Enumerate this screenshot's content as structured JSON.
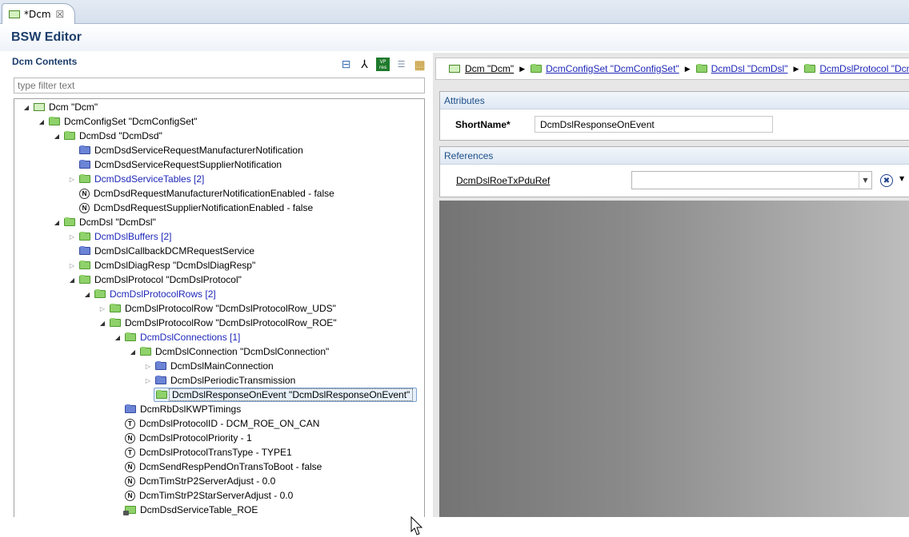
{
  "tab": {
    "title": "*Dcm",
    "close": "☒"
  },
  "editor": {
    "title": "BSW Editor"
  },
  "contents": {
    "title": "Dcm Contents",
    "filter_placeholder": "type filter text"
  },
  "toolbar": {
    "collapse": "⊟",
    "link": "⅄",
    "vp": "VP res",
    "doc": "☰",
    "grid": "▦"
  },
  "tree": [
    {
      "indent": 0,
      "tw": "open",
      "icon": "module",
      "label": "Dcm \"Dcm\"",
      "blue": false
    },
    {
      "indent": 1,
      "tw": "open",
      "icon": "green",
      "label": "DcmConfigSet \"DcmConfigSet\"",
      "blue": false
    },
    {
      "indent": 2,
      "tw": "open",
      "icon": "green",
      "label": "DcmDsd \"DcmDsd\"",
      "blue": false
    },
    {
      "indent": 3,
      "tw": "none",
      "icon": "blue",
      "label": "DcmDsdServiceRequestManufacturerNotification",
      "blue": false
    },
    {
      "indent": 3,
      "tw": "none",
      "icon": "blue",
      "label": "DcmDsdServiceRequestSupplierNotification",
      "blue": false
    },
    {
      "indent": 3,
      "tw": "closed",
      "icon": "green",
      "label": "DcmDsdServiceTables [2]",
      "blue": true
    },
    {
      "indent": 3,
      "tw": "none",
      "icon": "N",
      "label": "DcmDsdRequestManufacturerNotificationEnabled - false",
      "blue": false
    },
    {
      "indent": 3,
      "tw": "none",
      "icon": "N",
      "label": "DcmDsdRequestSupplierNotificationEnabled - false",
      "blue": false
    },
    {
      "indent": 2,
      "tw": "open",
      "icon": "green",
      "label": "DcmDsl \"DcmDsl\"",
      "blue": false
    },
    {
      "indent": 3,
      "tw": "closed",
      "icon": "green",
      "label": "DcmDslBuffers [2]",
      "blue": true
    },
    {
      "indent": 3,
      "tw": "none",
      "icon": "blue",
      "label": "DcmDslCallbackDCMRequestService",
      "blue": false
    },
    {
      "indent": 3,
      "tw": "closed",
      "icon": "green",
      "label": "DcmDslDiagResp \"DcmDslDiagResp\"",
      "blue": false
    },
    {
      "indent": 3,
      "tw": "open",
      "icon": "green",
      "label": "DcmDslProtocol \"DcmDslProtocol\"",
      "blue": false
    },
    {
      "indent": 4,
      "tw": "open",
      "icon": "green",
      "label": "DcmDslProtocolRows [2]",
      "blue": true
    },
    {
      "indent": 5,
      "tw": "closed",
      "icon": "green",
      "label": "DcmDslProtocolRow \"DcmDslProtocolRow_UDS\"",
      "blue": false
    },
    {
      "indent": 5,
      "tw": "open",
      "icon": "green",
      "label": "DcmDslProtocolRow \"DcmDslProtocolRow_ROE\"",
      "blue": false
    },
    {
      "indent": 6,
      "tw": "open",
      "icon": "green",
      "label": "DcmDslConnections [1]",
      "blue": true
    },
    {
      "indent": 7,
      "tw": "open",
      "icon": "green",
      "label": "DcmDslConnection \"DcmDslConnection\"",
      "blue": false
    },
    {
      "indent": 8,
      "tw": "closed",
      "icon": "blue",
      "label": "DcmDslMainConnection",
      "blue": false
    },
    {
      "indent": 8,
      "tw": "closed",
      "icon": "blue",
      "label": "DcmDslPeriodicTransmission",
      "blue": false
    },
    {
      "indent": 8,
      "tw": "none",
      "icon": "green",
      "label": "DcmDslResponseOnEvent \"DcmDslResponseOnEvent\"",
      "blue": false,
      "selected": true
    },
    {
      "indent": 6,
      "tw": "none",
      "icon": "blue",
      "label": "DcmRbDslKWPTimings",
      "blue": false
    },
    {
      "indent": 6,
      "tw": "none",
      "icon": "T",
      "label": "DcmDslProtocolID - DCM_ROE_ON_CAN",
      "blue": false
    },
    {
      "indent": 6,
      "tw": "none",
      "icon": "N",
      "label": "DcmDslProtocolPriority - 1",
      "blue": false
    },
    {
      "indent": 6,
      "tw": "none",
      "icon": "T",
      "label": "DcmDslProtocolTransType - TYPE1",
      "blue": false
    },
    {
      "indent": 6,
      "tw": "none",
      "icon": "N",
      "label": "DcmSendRespPendOnTransToBoot - false",
      "blue": false
    },
    {
      "indent": 6,
      "tw": "none",
      "icon": "N",
      "label": "DcmTimStrP2ServerAdjust - 0.0",
      "blue": false
    },
    {
      "indent": 6,
      "tw": "none",
      "icon": "N",
      "label": "DcmTimStrP2StarServerAdjust - 0.0",
      "blue": false
    },
    {
      "indent": 6,
      "tw": "none",
      "icon": "ref",
      "label": "DcmDsdServiceTable_ROE",
      "blue": false
    }
  ],
  "breadcrumb": [
    {
      "icon": "module",
      "label": "Dcm \"Dcm\"",
      "link": false
    },
    {
      "icon": "green",
      "label": "DcmConfigSet \"DcmConfigSet\"",
      "link": true
    },
    {
      "icon": "green",
      "label": "DcmDsl \"DcmDsl\"",
      "link": true
    },
    {
      "icon": "green",
      "label": "DcmDslProtocol \"DcmDslProtocol\"",
      "link": true
    }
  ],
  "attributes": {
    "header": "Attributes",
    "shortname_label": "ShortName*",
    "shortname_value": "DcmDslResponseOnEvent"
  },
  "references": {
    "header": "References",
    "ref_label": "DcmDslRoeTxPduRef",
    "ref_value": ""
  }
}
